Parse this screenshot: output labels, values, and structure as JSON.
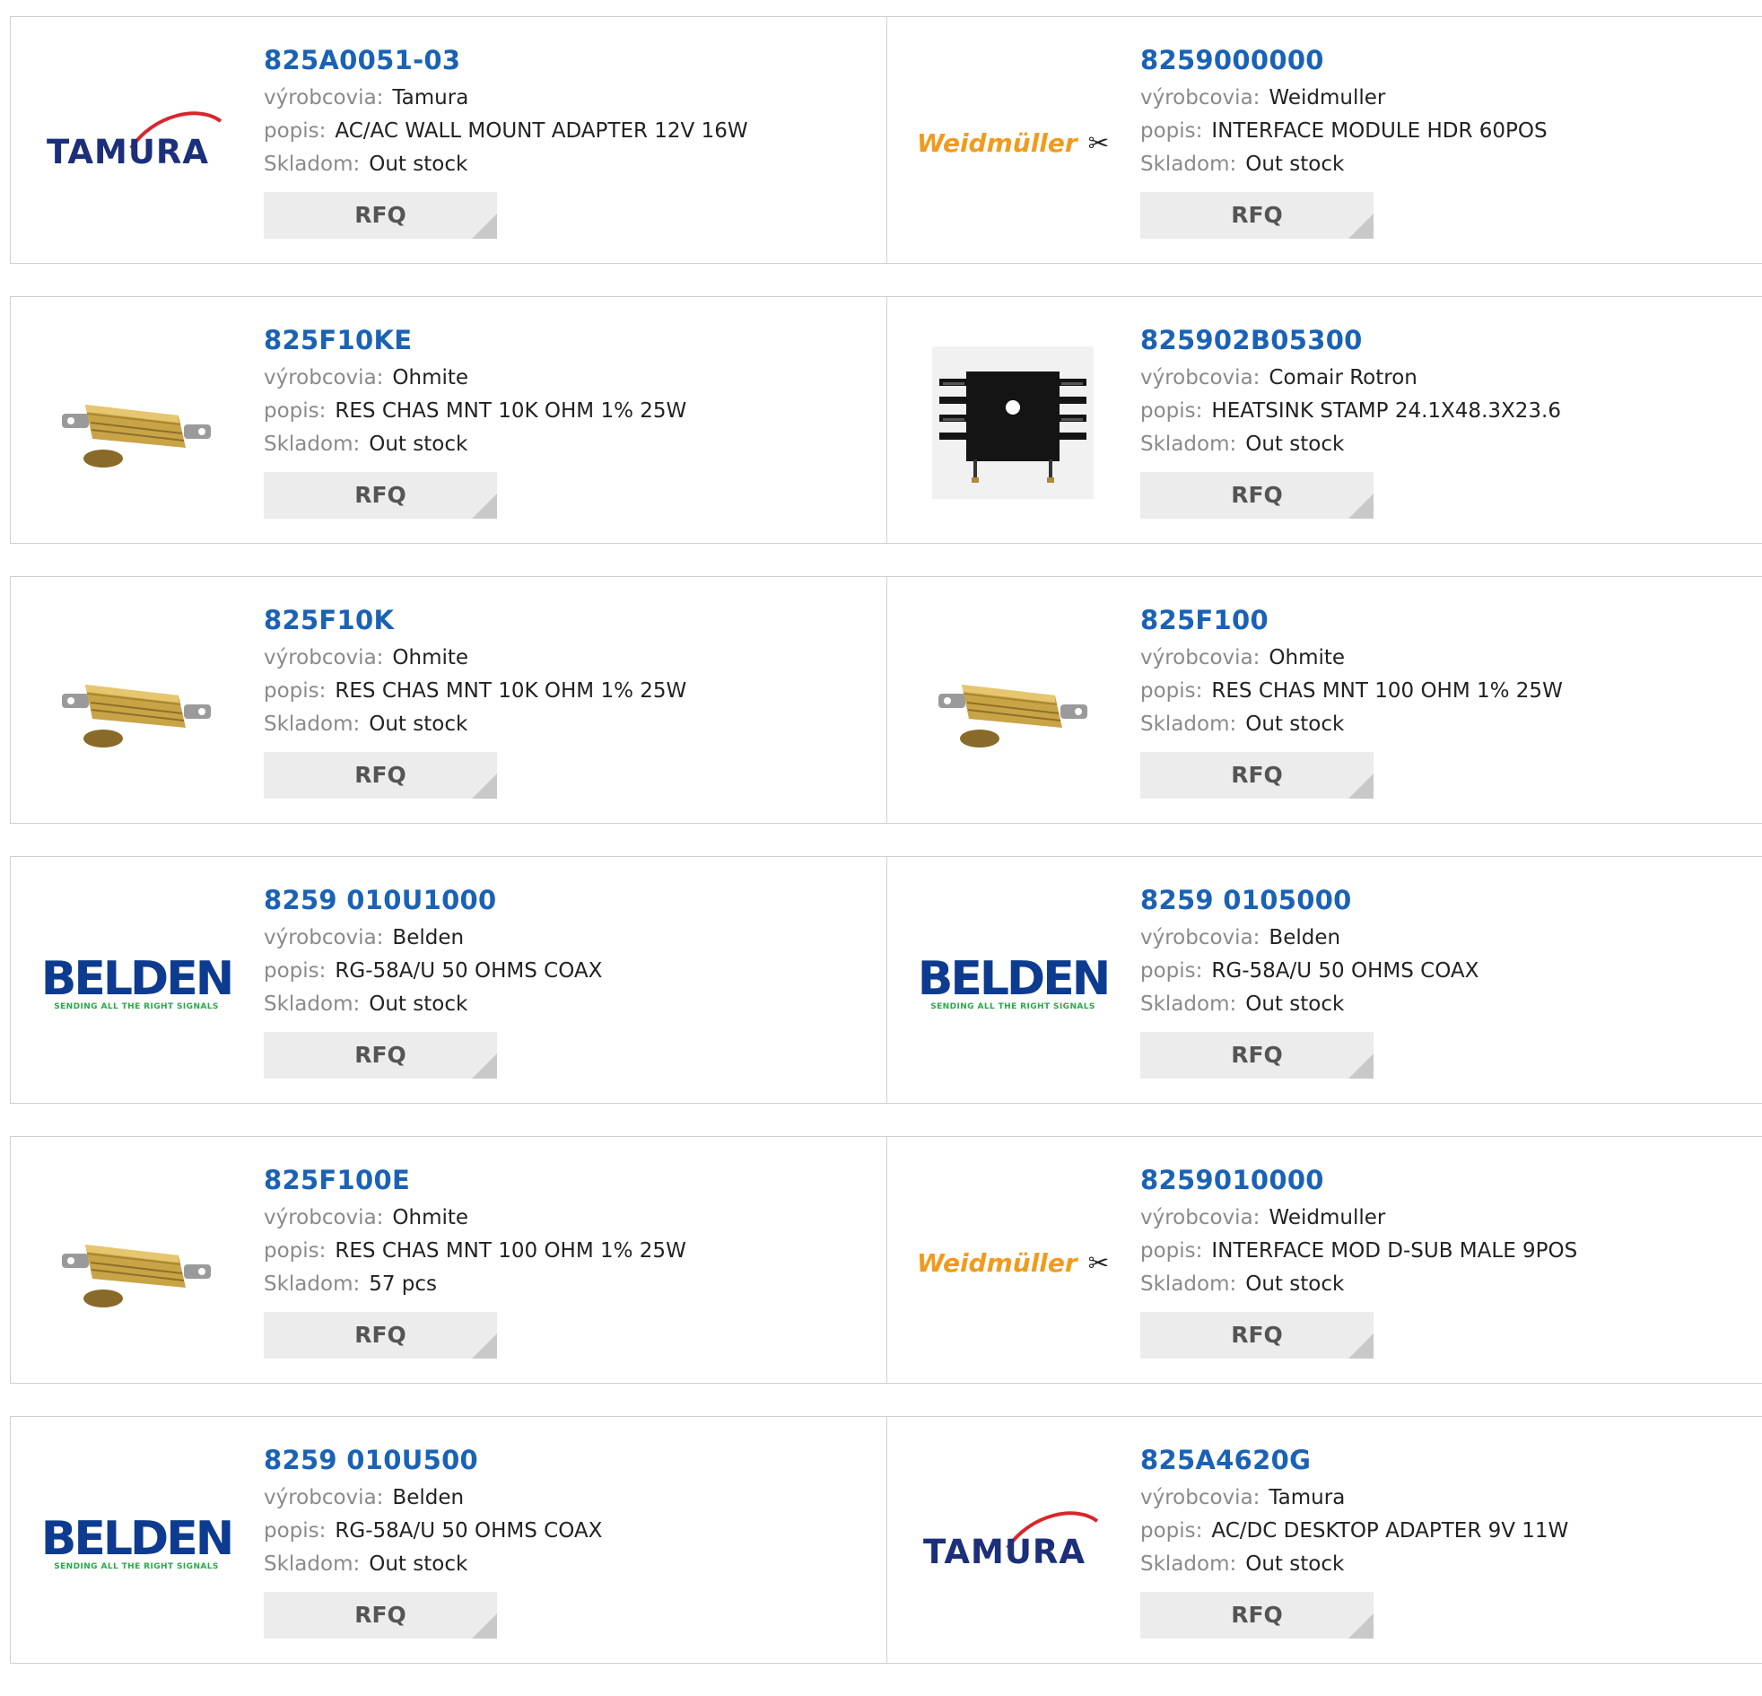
{
  "labels": {
    "manufacturer": "výrobcovia:",
    "description": "popis:",
    "stock": "Skladom:",
    "rfq": "RFQ"
  },
  "products": [
    {
      "part": "825A0051-03",
      "manufacturer": "Tamura",
      "description": "AC/AC WALL MOUNT ADAPTER 12V 16W",
      "stock": "Out stock",
      "image": "tamura-logo"
    },
    {
      "part": "8259000000",
      "manufacturer": "Weidmuller",
      "description": "INTERFACE MODULE HDR 60POS",
      "stock": "Out stock",
      "image": "weidmuller-logo"
    },
    {
      "part": "825F10KE",
      "manufacturer": "Ohmite",
      "description": "RES CHAS MNT 10K OHM 1% 25W",
      "stock": "Out stock",
      "image": "resistor-photo"
    },
    {
      "part": "825902B05300",
      "manufacturer": "Comair Rotron",
      "description": "HEATSINK STAMP 24.1X48.3X23.6",
      "stock": "Out stock",
      "image": "heatsink-photo"
    },
    {
      "part": "825F10K",
      "manufacturer": "Ohmite",
      "description": "RES CHAS MNT 10K OHM 1% 25W",
      "stock": "Out stock",
      "image": "resistor-photo"
    },
    {
      "part": "825F100",
      "manufacturer": "Ohmite",
      "description": "RES CHAS MNT 100 OHM 1% 25W",
      "stock": "Out stock",
      "image": "resistor-photo"
    },
    {
      "part": "8259 010U1000",
      "manufacturer": "Belden",
      "description": "RG-58A/U 50 OHMS COAX",
      "stock": "Out stock",
      "image": "belden-logo"
    },
    {
      "part": "8259 0105000",
      "manufacturer": "Belden",
      "description": "RG-58A/U 50 OHMS COAX",
      "stock": "Out stock",
      "image": "belden-logo"
    },
    {
      "part": "825F100E",
      "manufacturer": "Ohmite",
      "description": "RES CHAS MNT 100 OHM 1% 25W",
      "stock": "57 pcs",
      "image": "resistor-photo"
    },
    {
      "part": "8259010000",
      "manufacturer": "Weidmuller",
      "description": "INTERFACE MOD D-SUB MALE 9POS",
      "stock": "Out stock",
      "image": "weidmuller-logo"
    },
    {
      "part": "8259 010U500",
      "manufacturer": "Belden",
      "description": "RG-58A/U 50 OHMS COAX",
      "stock": "Out stock",
      "image": "belden-logo"
    },
    {
      "part": "825A4620G",
      "manufacturer": "Tamura",
      "description": "AC/DC DESKTOP ADAPTER 9V 11W",
      "stock": "Out stock",
      "image": "tamura-logo"
    }
  ],
  "logos": {
    "tamura": "TAMURA",
    "weidmuller": "Weidmüller",
    "weidmuller_mark": "✂",
    "belden": "BELDEN",
    "belden_tagline": "SENDING ALL THE RIGHT SIGNALS"
  },
  "colors": {
    "link": "#1a62b5",
    "label": "#8a8a8a",
    "border": "#cfcfcf",
    "button_bg": "#ececec",
    "tamura_blue": "#1c2f7a",
    "tamura_red": "#d8262c",
    "weidmuller_orange": "#f29a1d",
    "belden_blue": "#0d3b8f",
    "belden_green": "#2aa84a"
  }
}
